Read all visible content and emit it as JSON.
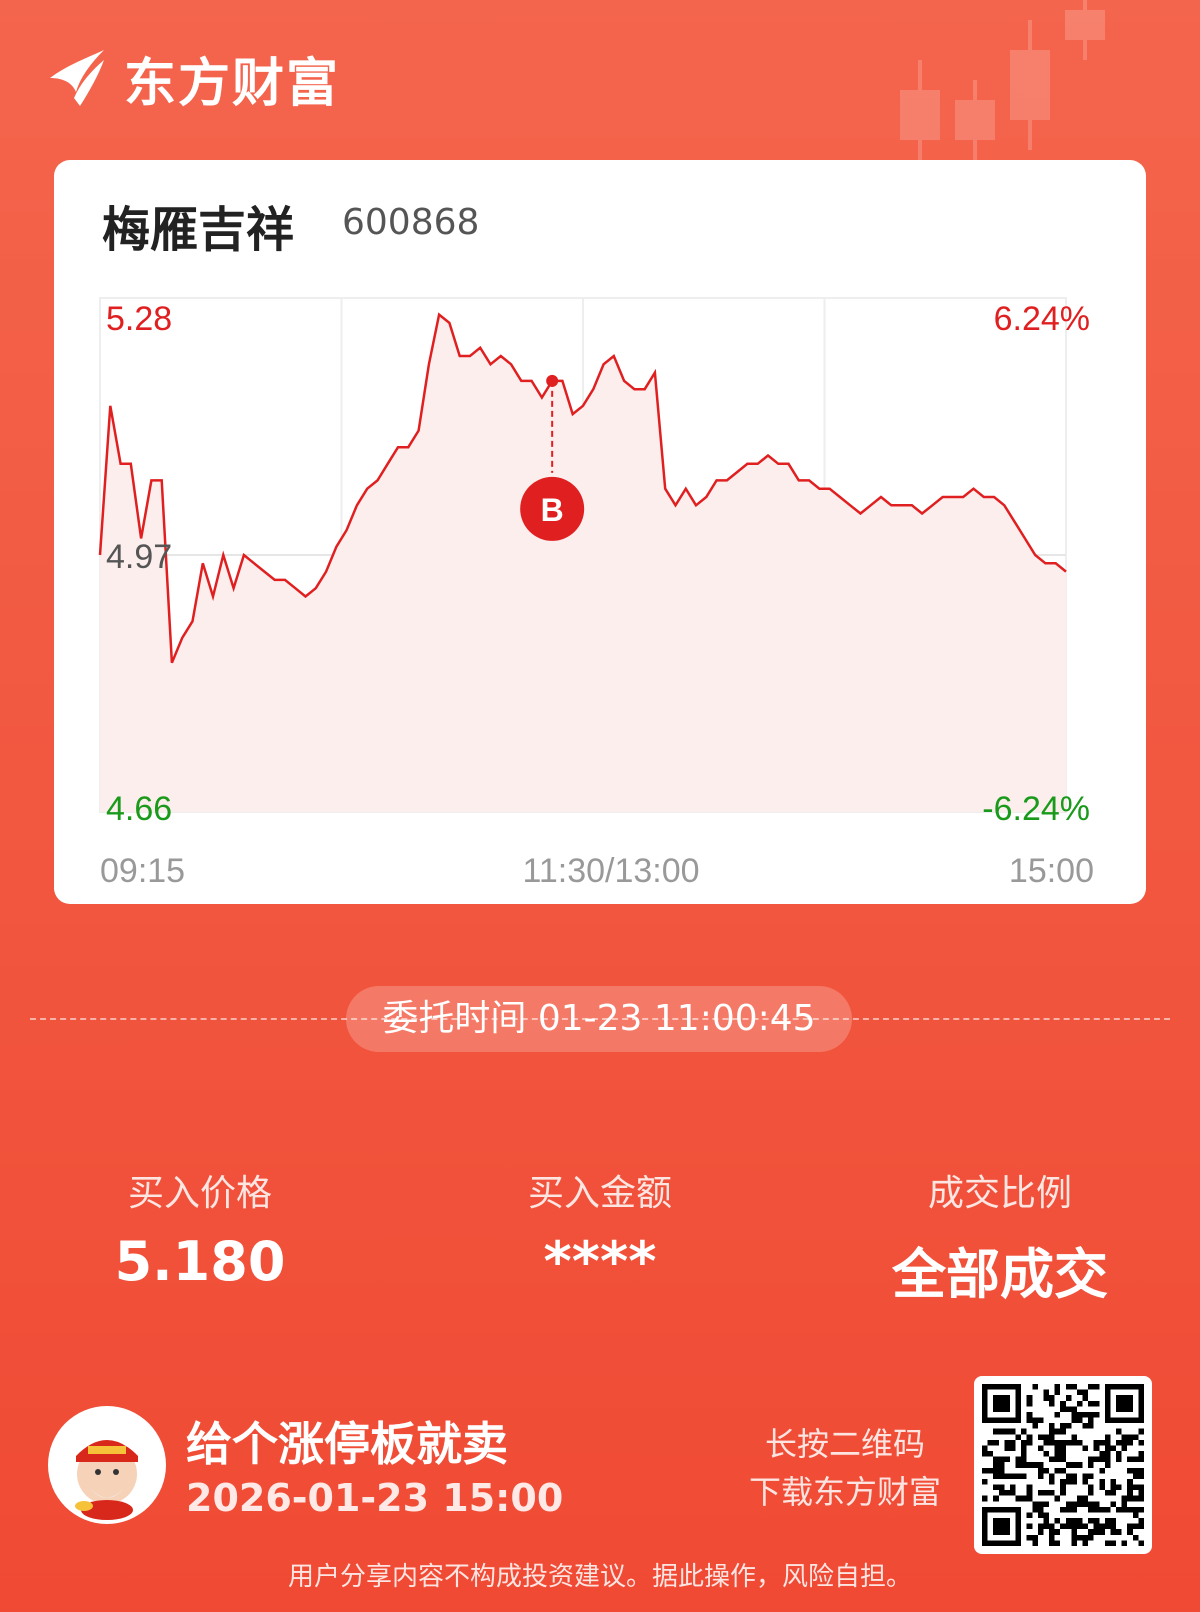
{
  "brand": {
    "name": "东方财富",
    "logo_icon": "eastmoney-logo-icon"
  },
  "stock": {
    "name": "梅雁吉祥",
    "code": "600868"
  },
  "chart_data": {
    "type": "line",
    "price_high_label": "5.28",
    "price_mid_label": "4.97",
    "price_low_label": "4.66",
    "pct_high_label": "6.24%",
    "pct_low_label": "-6.24%",
    "x_tick_labels": [
      "09:15",
      "11:30/13:00",
      "15:00"
    ],
    "ylim": [
      4.66,
      5.28
    ],
    "prev_close": 4.97,
    "buy_marker": {
      "label": "B",
      "x_index": 44,
      "price": 5.18
    },
    "values": [
      4.97,
      5.15,
      5.08,
      5.08,
      4.99,
      5.06,
      5.06,
      4.84,
      4.87,
      4.89,
      4.96,
      4.92,
      4.97,
      4.93,
      4.97,
      4.96,
      4.95,
      4.94,
      4.94,
      4.93,
      4.92,
      4.93,
      4.95,
      4.98,
      5.0,
      5.03,
      5.05,
      5.06,
      5.08,
      5.1,
      5.1,
      5.12,
      5.2,
      5.26,
      5.25,
      5.21,
      5.21,
      5.22,
      5.2,
      5.21,
      5.2,
      5.18,
      5.18,
      5.16,
      5.18,
      5.18,
      5.14,
      5.15,
      5.17,
      5.2,
      5.21,
      5.18,
      5.17,
      5.17,
      5.19,
      5.05,
      5.03,
      5.05,
      5.03,
      5.04,
      5.06,
      5.06,
      5.07,
      5.08,
      5.08,
      5.09,
      5.08,
      5.08,
      5.06,
      5.06,
      5.05,
      5.05,
      5.04,
      5.03,
      5.02,
      5.03,
      5.04,
      5.03,
      5.03,
      5.03,
      5.02,
      5.03,
      5.04,
      5.04,
      5.04,
      5.05,
      5.04,
      5.04,
      5.03,
      5.01,
      4.99,
      4.97,
      4.96,
      4.96,
      4.95
    ]
  },
  "order": {
    "time_label": "委托时间 01-23 11:00:45"
  },
  "stats": [
    {
      "label": "买入价格",
      "value": "5.180"
    },
    {
      "label": "买入金额",
      "value": "****"
    },
    {
      "label": "成交比例",
      "value": "全部成交"
    }
  ],
  "footer": {
    "avatar_icon": "cartoon-avatar-icon",
    "username": "给个涨停板就卖",
    "date": "2026-01-23 15:00",
    "qr_hint_line1": "长按二维码",
    "qr_hint_line2": "下载东方财富",
    "qr_icon": "qr-code-icon"
  },
  "disclaimer": "用户分享内容不构成投资建议。据此操作，风险自担。",
  "colors": {
    "up": "#e02020",
    "down": "#1a9a1a",
    "accent_bg": "#f25a42",
    "line_fill": "#fdecec"
  }
}
